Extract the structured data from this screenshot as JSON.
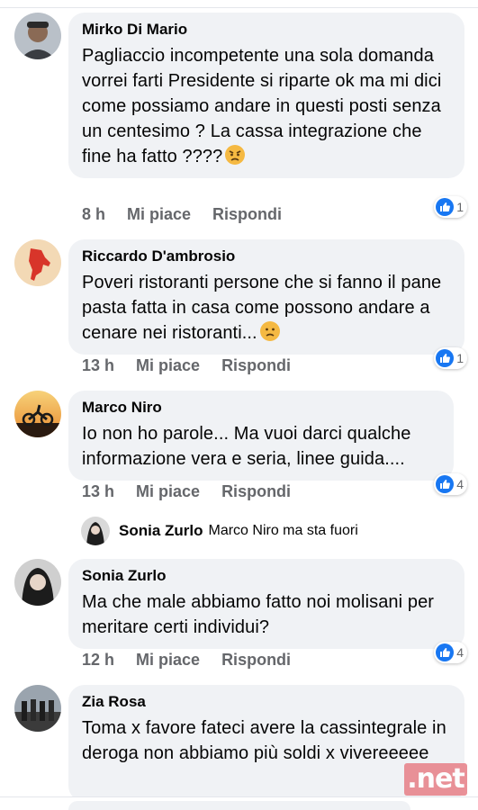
{
  "comments": [
    {
      "author": "Mirko Di Mario",
      "text": "Pagliaccio incompetente  una sola domanda vorrei farti Presidente si riparte ok ma mi dici come possiamo andare in questi posti senza un centesimo ? La cassa integrazione che fine ha fatto ????",
      "emoji": "angry-face-icon",
      "time": "8 h",
      "like_label": "Mi piace",
      "reply_label": "Rispondi",
      "reaction_count": "1"
    },
    {
      "author": "Riccardo D'ambrosio",
      "text": "Poveri ristoranti persone che si fanno il pane pasta fatta in casa come possono andare a cenare nei ristoranti...",
      "emoji": "worried-face-icon",
      "time": "13 h",
      "like_label": "Mi piace",
      "reply_label": "Rispondi",
      "reaction_count": "1"
    },
    {
      "author": "Marco Niro",
      "text": "Io non ho parole... Ma vuoi darci qualche informazione vera e seria, linee guida....",
      "time": "13 h",
      "like_label": "Mi piace",
      "reply_label": "Rispondi",
      "reaction_count": "4"
    },
    {
      "author": "Sonia Zurlo",
      "text": "Ma che male abbiamo fatto noi molisani per meritare certi individui?",
      "time": "12 h",
      "like_label": "Mi piace",
      "reply_label": "Rispondi",
      "reaction_count": "4"
    },
    {
      "author": "Zia Rosa",
      "text": "Toma x favore fateci avere la cassintegrale in deroga non abbiamo più soldi x vivereeeee"
    }
  ],
  "reply": {
    "author": "Sonia Zurlo",
    "text": "Marco Niro ma sta fuori"
  },
  "watermark": ".net",
  "colors": {
    "bubble": "#f0f2f5",
    "meta": "#65676b",
    "like_blue": "#1877f2",
    "watermark": "#e8868d"
  }
}
